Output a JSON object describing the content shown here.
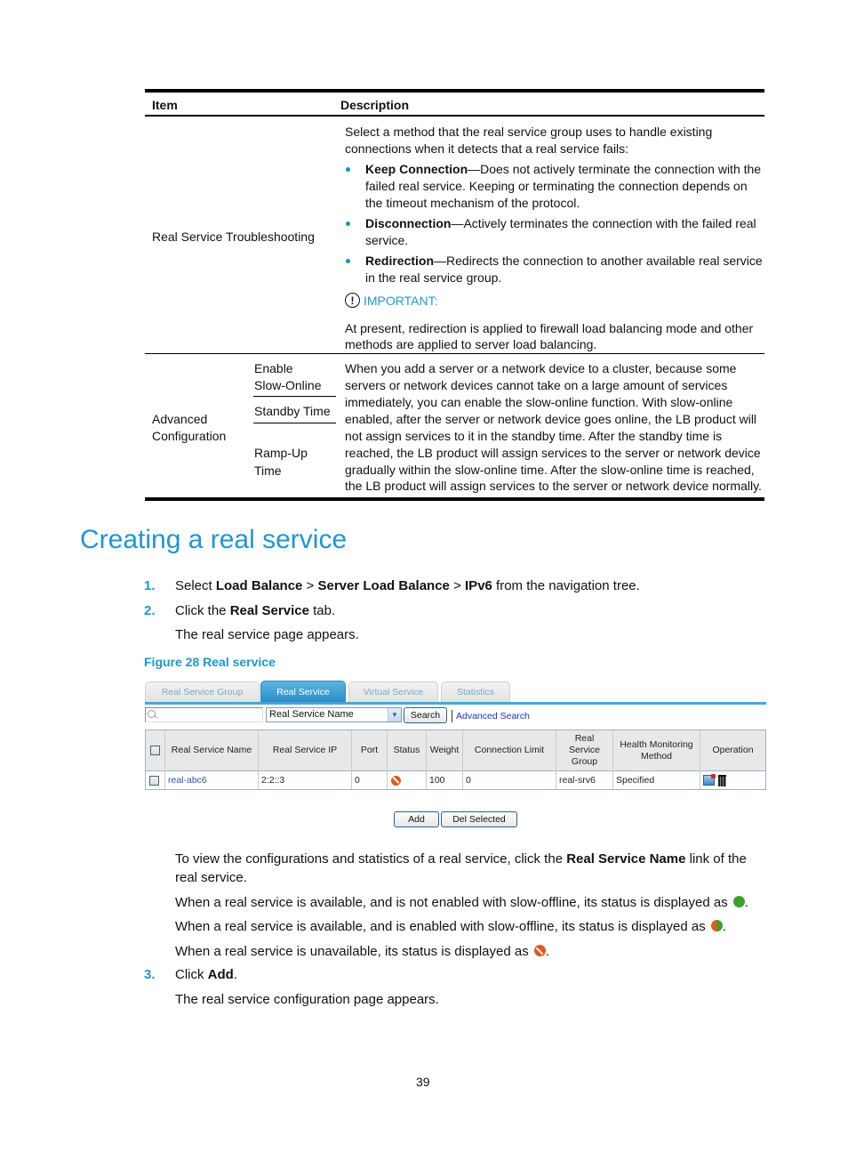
{
  "table": {
    "headers": {
      "item": "Item",
      "description": "Description"
    },
    "row1": {
      "item": "Real Service Troubleshooting",
      "intro_line1": "Select a method that the real service group uses to handle existing",
      "intro_line2": "connections when it detects that a real service fails:",
      "bullets": [
        {
          "term": "Keep Connection",
          "line1": "—Does not actively terminate the connection with the",
          "line2": "failed real service. Keeping or terminating the connection depends on",
          "line3": "the timeout mechanism of the protocol."
        },
        {
          "term": "Disconnection",
          "line1": "—Actively terminates the connection with the failed real",
          "line2": "service."
        },
        {
          "term": "Redirection",
          "line1": "—Redirects the connection to another available real service",
          "line2": "in the real service group."
        }
      ],
      "important_label": "IMPORTANT:",
      "important_icon": "!",
      "note_line1": "At present, redirection is applied to firewall load balancing mode and other",
      "note_line2": "methods are applied to server load balancing."
    },
    "row2": {
      "item_line1": "Advanced",
      "item_line2": "Configuration",
      "subitems": [
        {
          "line1": "Enable",
          "line2": "Slow-Online"
        },
        {
          "line1": "Standby Time"
        },
        {
          "line1": "Ramp-Up",
          "line2": "Time"
        }
      ],
      "description_lines": [
        "When you add a server or a network device to a cluster, because some",
        "servers or network devices cannot take on a large amount of services",
        "immediately, you can enable the slow-online function. With slow-online",
        "enabled, after the server or network device goes online, the LB product will",
        "not assign services to it in the standby time. After the standby time is",
        "reached, the LB product will assign services to the server or network device",
        "gradually within the slow-online time. After the slow-online time is reached,",
        "the LB product will assign services to the server or network device normally."
      ]
    }
  },
  "section_title": "Creating a real service",
  "steps": [
    {
      "num": "1.",
      "pre": "Select ",
      "b1": "Load Balance",
      "s1": " > ",
      "b2": "Server Load Balance",
      "s2": " > ",
      "b3": "IPv6",
      "post": " from the navigation tree."
    },
    {
      "num": "2.",
      "pre": "Click the ",
      "b1": "Real Service",
      "post": " tab.",
      "result": "The real service page appears."
    },
    {
      "num": "3.",
      "pre": "Click ",
      "b1": "Add",
      "post": ".",
      "result": "The real service configuration page appears."
    }
  ],
  "figure_caption": "Figure 28 Real service",
  "ui": {
    "tabs": [
      {
        "label": "Real Service Group",
        "active": false
      },
      {
        "label": "Real Service",
        "active": true
      },
      {
        "label": "Virtual Service",
        "active": false
      },
      {
        "label": "Statistics",
        "active": false
      }
    ],
    "search_value": "",
    "search_field_selected": "Real Service Name",
    "search_button": "Search",
    "advanced_search": "Advanced Search",
    "columns": [
      "Real Service Name",
      "Real Service IP",
      "Port",
      "Status",
      "Weight",
      "Connection Limit",
      "Real Service Group",
      "Health Monitoring Method",
      "Operation"
    ],
    "rows": [
      {
        "name": "real-abc6",
        "ip": "2:2::3",
        "port": "0",
        "status": "unavailable",
        "weight": "100",
        "conn_limit": "0",
        "group": "real-srv6",
        "health": "Specified"
      }
    ],
    "add_button": "Add",
    "del_selected_button": "Del Selected",
    "status_colors": {
      "available": "#3aa02a",
      "unavailable": "#e05a1c"
    }
  },
  "after_figure": {
    "p1_pre": "To view the configurations and statistics of a real service, click the ",
    "p1_bold": "Real Service Name",
    "p1_post": " link of the",
    "p1_line2": "real service.",
    "p2": "When a real service is available, and is not enabled with slow-offline, its status is displayed as",
    "p3": "When a real service is available, and is enabled with slow-offline, its status is displayed as",
    "p4": "When a real service is unavailable, its status is displayed as"
  },
  "page_number": "39"
}
